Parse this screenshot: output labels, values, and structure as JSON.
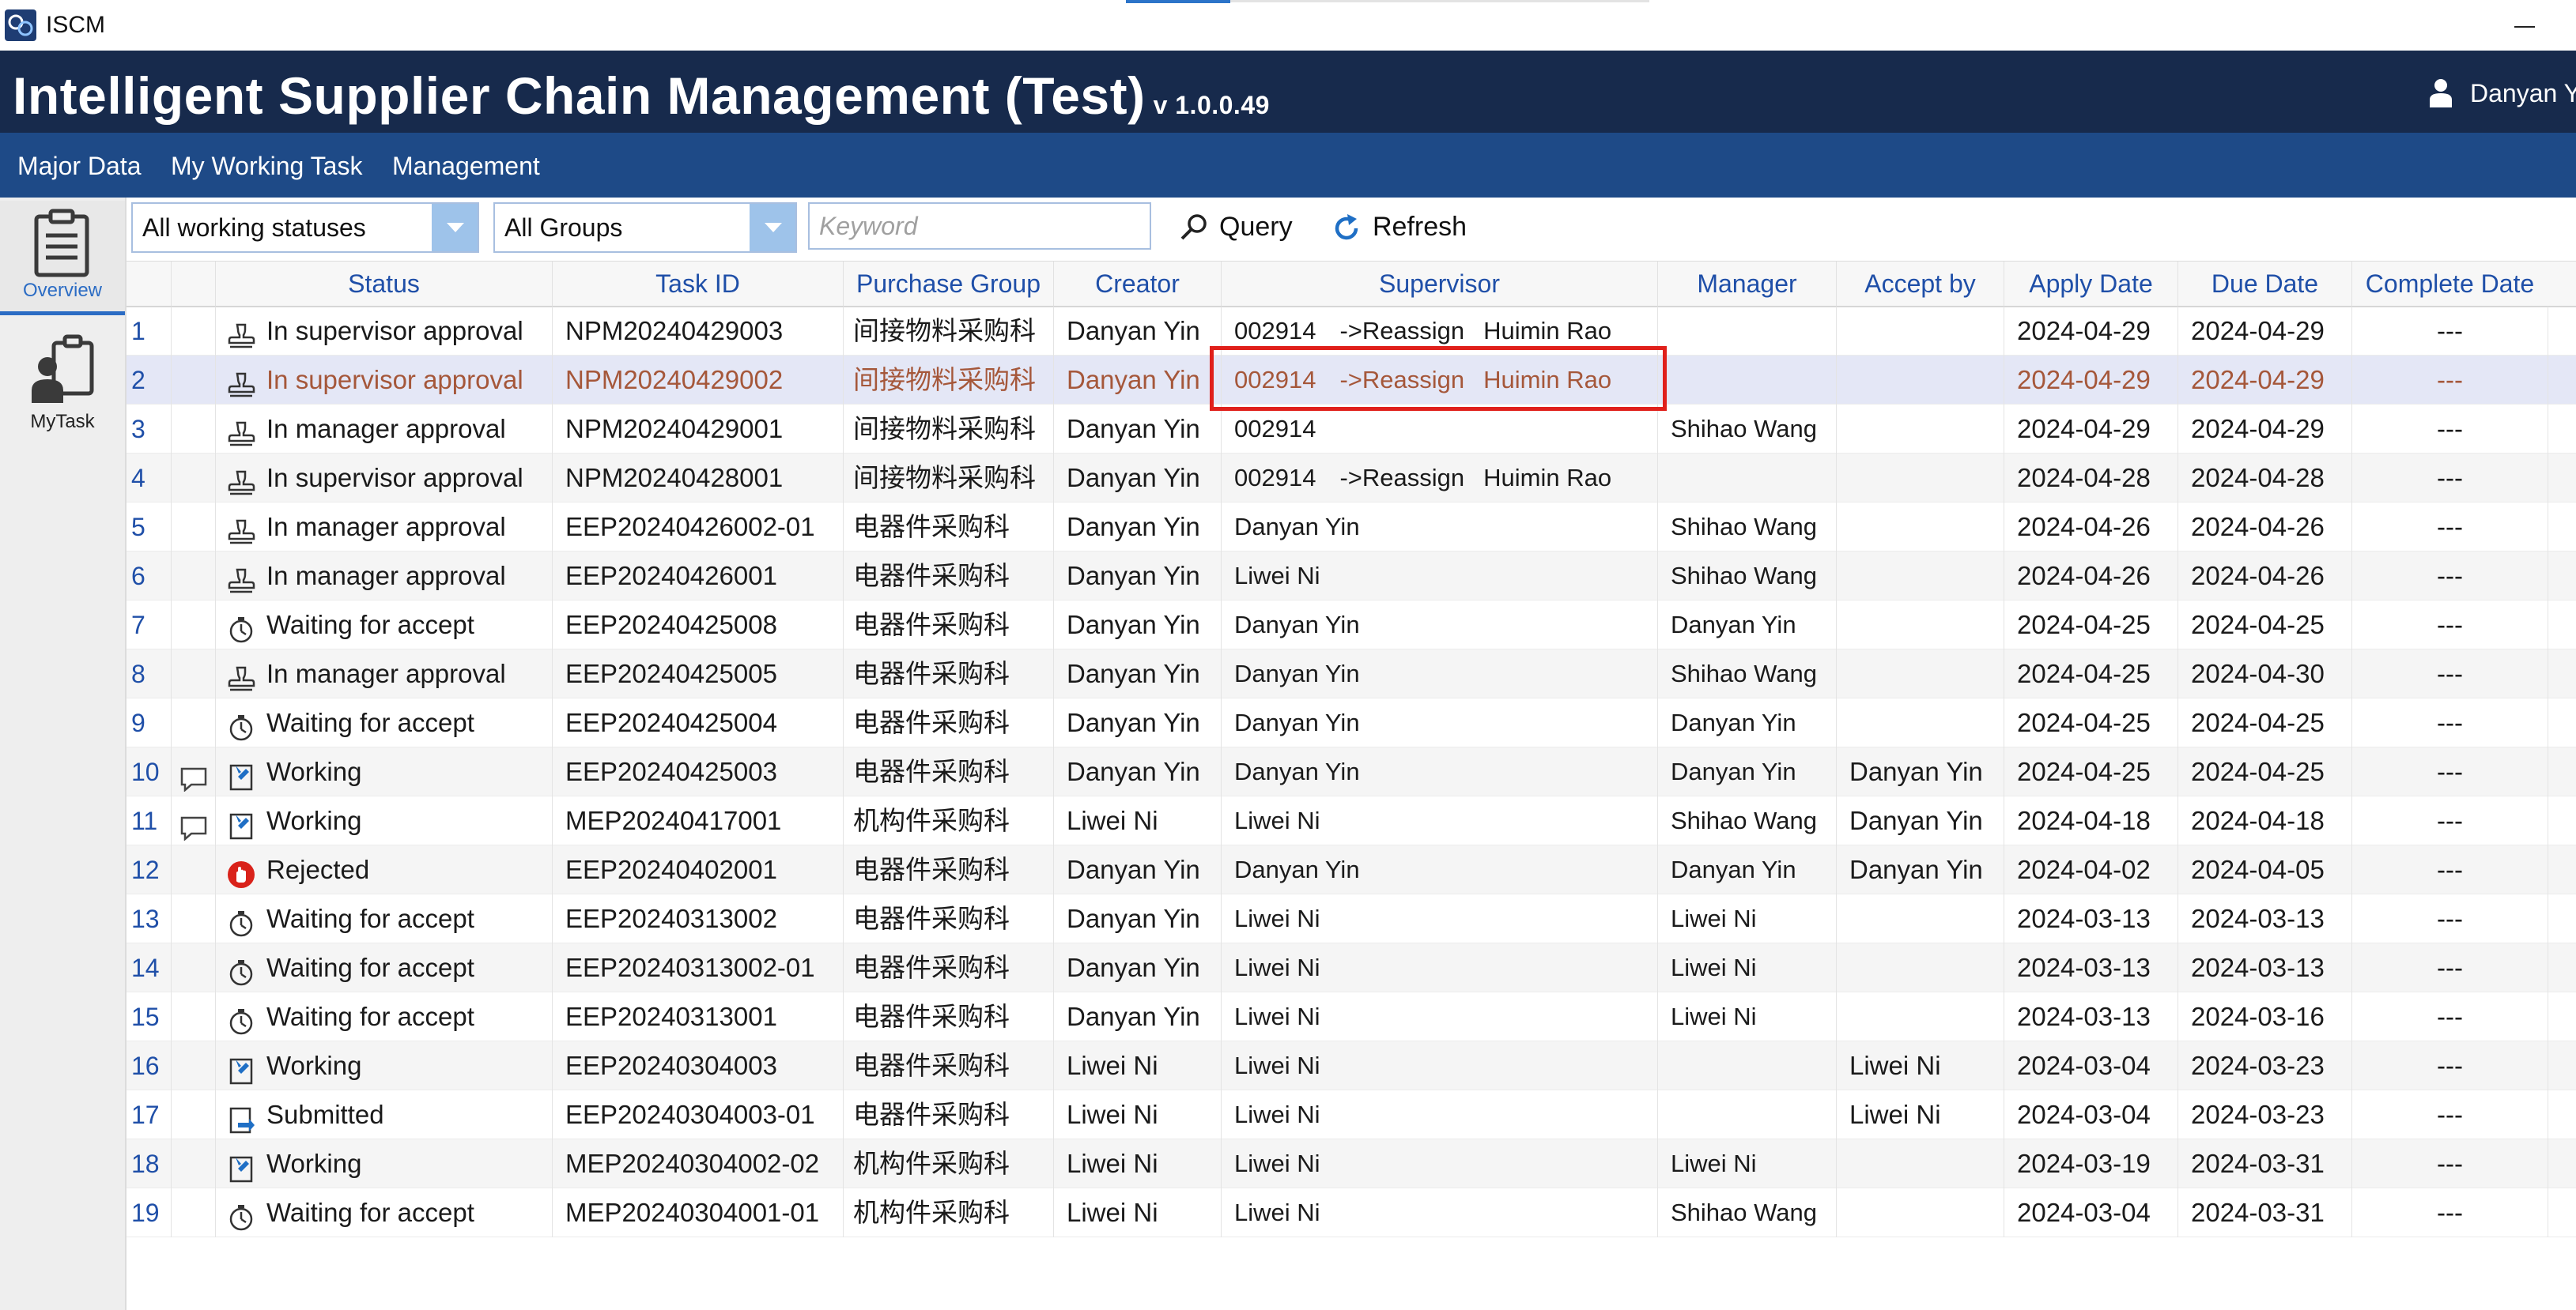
{
  "window": {
    "app_name": "ISCM"
  },
  "header": {
    "title": "Intelligent Supplier Chain Management (Test)",
    "version": "v 1.0.0.49",
    "user": "Danyan Y"
  },
  "menu": [
    "Major Data",
    "My Working Task",
    "Management"
  ],
  "nav": {
    "overview_label": "Overview",
    "mytask_label": "MyTask"
  },
  "toolbar": {
    "status_filter": "All working statuses",
    "group_filter": "All Groups",
    "keyword_placeholder": "Keyword",
    "query_label": "Query",
    "refresh_label": "Refresh"
  },
  "grid": {
    "columns": [
      "Status",
      "Task ID",
      "Purchase Group",
      "Creator",
      "Supervisor",
      "Manager",
      "Accept by",
      "Apply Date",
      "Due Date",
      "Complete Date"
    ],
    "rows": [
      {
        "n": "1",
        "comment": false,
        "icon": "stamp-icon",
        "status": "In supervisor approval",
        "task_id": "NPM20240429003",
        "group": "间接物料采购科",
        "creator": "Danyan Yin",
        "sup_id": "002914",
        "sup_reassign": "->Reassign",
        "sup_name": "Huimin Rao",
        "manager": "",
        "accept_by": "",
        "apply": "2024-04-29",
        "due": "2024-04-29",
        "complete": "---"
      },
      {
        "n": "2",
        "comment": false,
        "icon": "stamp-icon",
        "status": "In supervisor approval",
        "task_id": "NPM20240429002",
        "group": "间接物料采购科",
        "creator": "Danyan Yin",
        "sup_id": "002914",
        "sup_reassign": "->Reassign",
        "sup_name": "Huimin Rao",
        "manager": "",
        "accept_by": "",
        "apply": "2024-04-29",
        "due": "2024-04-29",
        "complete": "---"
      },
      {
        "n": "3",
        "comment": false,
        "icon": "stamp-icon",
        "status": "In manager approval",
        "task_id": "NPM20240429001",
        "group": "间接物料采购科",
        "creator": "Danyan Yin",
        "sup_id": "002914",
        "sup_reassign": "",
        "sup_name": "",
        "manager": "Shihao Wang",
        "accept_by": "",
        "apply": "2024-04-29",
        "due": "2024-04-29",
        "complete": "---"
      },
      {
        "n": "4",
        "comment": false,
        "icon": "stamp-icon",
        "status": "In supervisor approval",
        "task_id": "NPM20240428001",
        "group": "间接物料采购科",
        "creator": "Danyan Yin",
        "sup_id": "002914",
        "sup_reassign": "->Reassign",
        "sup_name": "Huimin Rao",
        "manager": "",
        "accept_by": "",
        "apply": "2024-04-28",
        "due": "2024-04-28",
        "complete": "---"
      },
      {
        "n": "5",
        "comment": false,
        "icon": "stamp-icon",
        "status": "In manager approval",
        "task_id": "EEP20240426002-01",
        "group": "电器件采购科",
        "creator": "Danyan Yin",
        "sup_id": "Danyan Yin",
        "sup_reassign": "",
        "sup_name": "",
        "manager": "Shihao Wang",
        "accept_by": "",
        "apply": "2024-04-26",
        "due": "2024-04-26",
        "complete": "---"
      },
      {
        "n": "6",
        "comment": false,
        "icon": "stamp-icon",
        "status": "In manager approval",
        "task_id": "EEP20240426001",
        "group": "电器件采购科",
        "creator": "Danyan Yin",
        "sup_id": "Liwei Ni",
        "sup_reassign": "",
        "sup_name": "",
        "manager": "Shihao Wang",
        "accept_by": "",
        "apply": "2024-04-26",
        "due": "2024-04-26",
        "complete": "---"
      },
      {
        "n": "7",
        "comment": false,
        "icon": "stopwatch-icon",
        "status": "Waiting for accept",
        "task_id": "EEP20240425008",
        "group": "电器件采购科",
        "creator": "Danyan Yin",
        "sup_id": "Danyan Yin",
        "sup_reassign": "",
        "sup_name": "",
        "manager": "Danyan Yin",
        "accept_by": "",
        "apply": "2024-04-25",
        "due": "2024-04-25",
        "complete": "---"
      },
      {
        "n": "8",
        "comment": false,
        "icon": "stamp-icon",
        "status": "In manager approval",
        "task_id": "EEP20240425005",
        "group": "电器件采购科",
        "creator": "Danyan Yin",
        "sup_id": "Danyan Yin",
        "sup_reassign": "",
        "sup_name": "",
        "manager": "Shihao Wang",
        "accept_by": "",
        "apply": "2024-04-25",
        "due": "2024-04-30",
        "complete": "---"
      },
      {
        "n": "9",
        "comment": false,
        "icon": "stopwatch-icon",
        "status": "Waiting for accept",
        "task_id": "EEP20240425004",
        "group": "电器件采购科",
        "creator": "Danyan Yin",
        "sup_id": "Danyan Yin",
        "sup_reassign": "",
        "sup_name": "",
        "manager": "Danyan Yin",
        "accept_by": "",
        "apply": "2024-04-25",
        "due": "2024-04-25",
        "complete": "---"
      },
      {
        "n": "10",
        "comment": true,
        "icon": "working-doc-icon",
        "status": "Working",
        "task_id": "EEP20240425003",
        "group": "电器件采购科",
        "creator": "Danyan Yin",
        "sup_id": "Danyan Yin",
        "sup_reassign": "",
        "sup_name": "",
        "manager": "Danyan Yin",
        "accept_by": "Danyan Yin",
        "apply": "2024-04-25",
        "due": "2024-04-25",
        "complete": "---"
      },
      {
        "n": "11",
        "comment": true,
        "icon": "working-doc-icon",
        "status": "Working",
        "task_id": "MEP20240417001",
        "group": "机构件采购科",
        "creator": "Liwei Ni",
        "sup_id": "Liwei Ni",
        "sup_reassign": "",
        "sup_name": "",
        "manager": "Shihao Wang",
        "accept_by": "Danyan Yin",
        "apply": "2024-04-18",
        "due": "2024-04-18",
        "complete": "---"
      },
      {
        "n": "12",
        "comment": false,
        "icon": "rejected-icon",
        "status": "Rejected",
        "task_id": "EEP20240402001",
        "group": "电器件采购科",
        "creator": "Danyan Yin",
        "sup_id": "Danyan Yin",
        "sup_reassign": "",
        "sup_name": "",
        "manager": "Danyan Yin",
        "accept_by": "Danyan Yin",
        "apply": "2024-04-02",
        "due": "2024-04-05",
        "complete": "---"
      },
      {
        "n": "13",
        "comment": false,
        "icon": "stopwatch-icon",
        "status": "Waiting for accept",
        "task_id": "EEP20240313002",
        "group": "电器件采购科",
        "creator": "Danyan Yin",
        "sup_id": "Liwei Ni",
        "sup_reassign": "",
        "sup_name": "",
        "manager": "Liwei Ni",
        "accept_by": "",
        "apply": "2024-03-13",
        "due": "2024-03-13",
        "complete": "---"
      },
      {
        "n": "14",
        "comment": false,
        "icon": "stopwatch-icon",
        "status": "Waiting for accept",
        "task_id": "EEP20240313002-01",
        "group": "电器件采购科",
        "creator": "Danyan Yin",
        "sup_id": "Liwei Ni",
        "sup_reassign": "",
        "sup_name": "",
        "manager": "Liwei Ni",
        "accept_by": "",
        "apply": "2024-03-13",
        "due": "2024-03-13",
        "complete": "---"
      },
      {
        "n": "15",
        "comment": false,
        "icon": "stopwatch-icon",
        "status": "Waiting for accept",
        "task_id": "EEP20240313001",
        "group": "电器件采购科",
        "creator": "Danyan Yin",
        "sup_id": "Liwei Ni",
        "sup_reassign": "",
        "sup_name": "",
        "manager": "Liwei Ni",
        "accept_by": "",
        "apply": "2024-03-13",
        "due": "2024-03-16",
        "complete": "---"
      },
      {
        "n": "16",
        "comment": false,
        "icon": "working-doc-icon",
        "status": "Working",
        "task_id": "EEP20240304003",
        "group": "电器件采购科",
        "creator": "Liwei Ni",
        "sup_id": "Liwei Ni",
        "sup_reassign": "",
        "sup_name": "",
        "manager": "",
        "accept_by": "Liwei Ni",
        "apply": "2024-03-04",
        "due": "2024-03-23",
        "complete": "---"
      },
      {
        "n": "17",
        "comment": false,
        "icon": "submitted-icon",
        "status": "Submitted",
        "task_id": "EEP20240304003-01",
        "group": "电器件采购科",
        "creator": "Liwei Ni",
        "sup_id": "Liwei Ni",
        "sup_reassign": "",
        "sup_name": "",
        "manager": "",
        "accept_by": "Liwei Ni",
        "apply": "2024-03-04",
        "due": "2024-03-23",
        "complete": "---"
      },
      {
        "n": "18",
        "comment": false,
        "icon": "working-doc-icon",
        "status": "Working",
        "task_id": "MEP20240304002-02",
        "group": "机构件采购科",
        "creator": "Liwei Ni",
        "sup_id": "Liwei Ni",
        "sup_reassign": "",
        "sup_name": "",
        "manager": "Liwei Ni",
        "accept_by": "",
        "apply": "2024-03-19",
        "due": "2024-03-31",
        "complete": "---"
      },
      {
        "n": "19",
        "comment": false,
        "icon": "stopwatch-icon",
        "status": "Waiting for accept",
        "task_id": "MEP20240304001-01",
        "group": "机构件采购科",
        "creator": "Liwei Ni",
        "sup_id": "Liwei Ni",
        "sup_reassign": "",
        "sup_name": "",
        "manager": "Shihao Wang",
        "accept_by": "",
        "apply": "2024-03-04",
        "due": "2024-03-31",
        "complete": "---"
      }
    ]
  },
  "colors": {
    "banner": "#172a4c",
    "menubar": "#1e4a87",
    "accent": "#2b6cc4",
    "selected_text": "#a5573a",
    "highlight": "#e0201b"
  }
}
